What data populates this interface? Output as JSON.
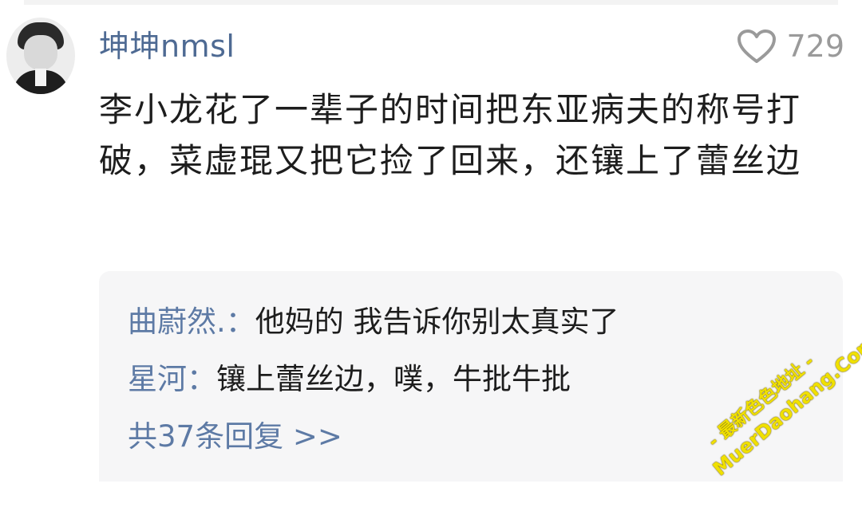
{
  "comment": {
    "username": "坤坤nmsl",
    "like_count": "729",
    "like_icon": "heart-outline-icon",
    "text": "李小龙花了一辈子的时间把东亚病夫的称号打破，菜虚琨又把它捡了回来，还镶上了蕾丝边"
  },
  "replies": [
    {
      "name": "曲蔚然.",
      "separator": "：",
      "text": "他妈的  我告诉你别太真实了"
    },
    {
      "name": "星河",
      "separator": "：",
      "text": "镶上蕾丝边，噗，牛批牛批"
    }
  ],
  "more_replies": "共37条回复 >>",
  "watermark": {
    "line1": "- 最新色色地址 -",
    "line2": "MuerDaohang.Com"
  },
  "colors": {
    "username": "#4e6a93",
    "reply_name": "#5d7aa5",
    "watermark": "#f0e000"
  }
}
